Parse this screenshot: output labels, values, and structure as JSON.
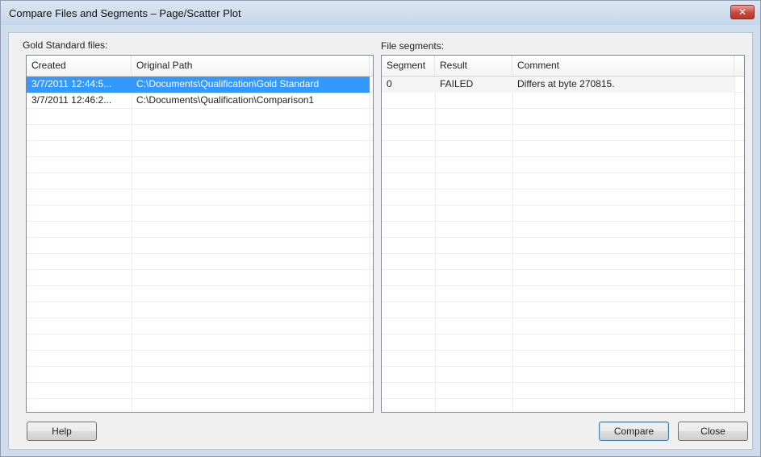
{
  "window": {
    "title": "Compare Files and Segments – Page/Scatter Plot",
    "close_glyph": "✕"
  },
  "gold": {
    "label": "Gold Standard files:",
    "columns": [
      "Created",
      "Original Path"
    ],
    "rows": [
      {
        "created": "3/7/2011 12:44:5...",
        "path": "C:\\Documents\\Qualification\\Gold Standard",
        "selected": true
      },
      {
        "created": "3/7/2011 12:46:2...",
        "path": "C:\\Documents\\Qualification\\Comparison1",
        "selected": false
      }
    ]
  },
  "segments": {
    "label": "File segments:",
    "columns": [
      "Segment",
      "Result",
      "Comment"
    ],
    "rows": [
      {
        "segment": "0",
        "result": "FAILED",
        "comment": "Differs at byte 270815."
      }
    ]
  },
  "buttons": {
    "help": "Help",
    "compare": "Compare",
    "close": "Close"
  },
  "colors": {
    "selection": "#3399ff",
    "close_button": "#c7483a",
    "titlebar": "#cfdceb"
  }
}
